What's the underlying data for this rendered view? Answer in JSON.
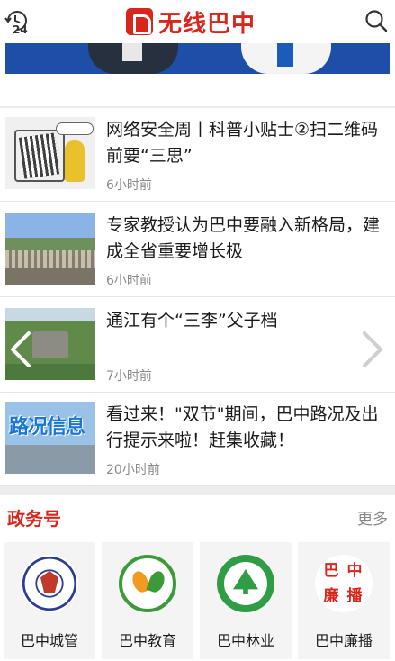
{
  "header": {
    "brand_title": "无线巴中",
    "history_count": "24",
    "brand_color": "#d9261c"
  },
  "news": [
    {
      "headline": "网络安全周丨科普小贴士②扫二维码前要“三思”",
      "time": "6小时前"
    },
    {
      "headline": "专家教授认为巴中要融入新格局，建成全省重要增长极",
      "time": "6小时前"
    },
    {
      "headline": "通江有个“三李”父子档",
      "time": "7小时前"
    },
    {
      "headline": "看过来！\"双节\"期间，巴中路况及出行提示来啦！赶集收藏！",
      "time": "20小时前"
    }
  ],
  "thumb4_text": "路况信息",
  "gov_section": {
    "title": "政务号",
    "more_label": "更多",
    "accounts": [
      {
        "label": "巴中城管",
        "icon": "chengguan-logo"
      },
      {
        "label": "巴中教育",
        "icon": "education-logo"
      },
      {
        "label": "巴中林业",
        "icon": "forestry-logo"
      },
      {
        "label": "巴中廉播",
        "icon": "lianbo-logo",
        "logo_chars": [
          "巴",
          "中",
          "廉",
          "播"
        ]
      }
    ]
  },
  "colors": {
    "accent": "#d9261c",
    "banner_blue": "#1d4fa8",
    "time_gray": "#8a8a8a"
  }
}
